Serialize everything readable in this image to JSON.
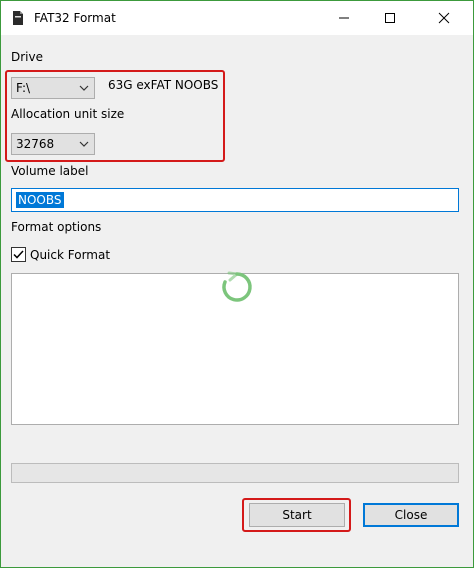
{
  "window": {
    "title": "FAT32 Format",
    "icon": "app-icon"
  },
  "drive": {
    "label": "Drive",
    "selected": "F:\\",
    "description": "63G exFAT NOOBS"
  },
  "allocation": {
    "label": "Allocation unit size",
    "selected": "32768"
  },
  "volume": {
    "label": "Volume label",
    "value": "NOOBS"
  },
  "format_options": {
    "label": "Format options",
    "quick_format_label": "Quick Format",
    "quick_format_checked": true
  },
  "progress": {
    "value": 0
  },
  "buttons": {
    "start": "Start",
    "close": "Close"
  },
  "colors": {
    "accent": "#0078d7",
    "highlight_box": "#d41a1a",
    "window_border": "#3c9a3c",
    "spinner": "#7cc57c"
  }
}
